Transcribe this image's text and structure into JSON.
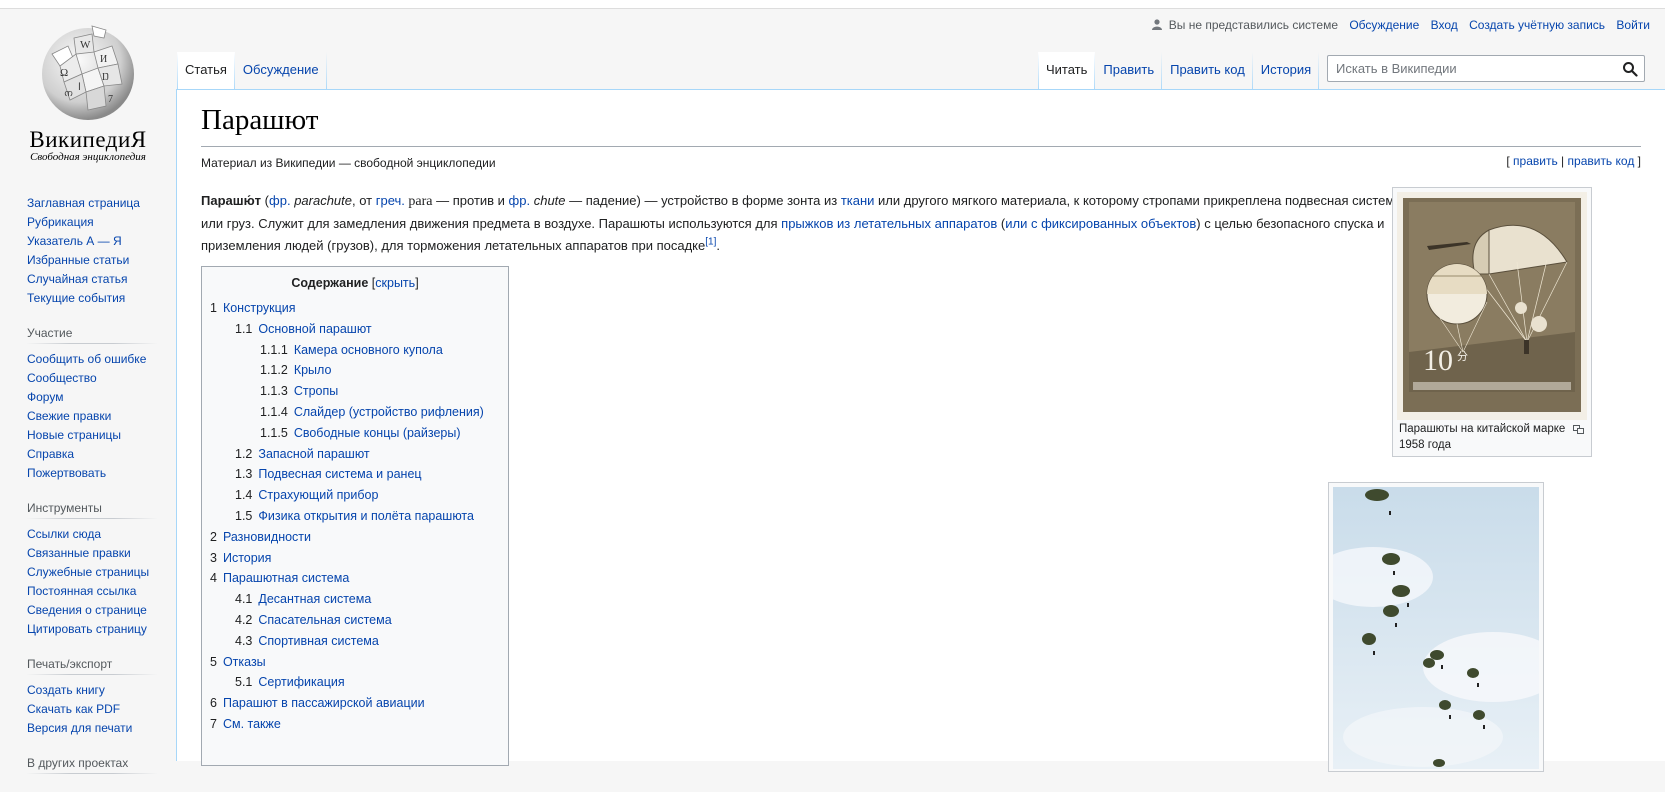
{
  "logo": {
    "wordmark": "ВикипедиЯ",
    "tagline": "Свободная энциклопедия"
  },
  "sidebar": {
    "navigation": [
      "Заглавная страница",
      "Рубрикация",
      "Указатель А — Я",
      "Избранные статьи",
      "Случайная статья",
      "Текущие события"
    ],
    "participation": {
      "heading": "Участие",
      "items": [
        "Сообщить об ошибке",
        "Сообщество",
        "Форум",
        "Свежие правки",
        "Новые страницы",
        "Справка",
        "Пожертвовать"
      ]
    },
    "tools": {
      "heading": "Инструменты",
      "items": [
        "Ссылки сюда",
        "Связанные правки",
        "Служебные страницы",
        "Постоянная ссылка",
        "Сведения о странице",
        "Цитировать страницу"
      ]
    },
    "print": {
      "heading": "Печать/экспорт",
      "items": [
        "Создать книгу",
        "Скачать как PDF",
        "Версия для печати"
      ]
    },
    "other": {
      "heading": "В других проектах"
    }
  },
  "personal": {
    "not_logged": "Вы не представились системе",
    "talk": "Обсуждение",
    "login": "Вход",
    "create": "Создать учётную запись",
    "logout": "Войти"
  },
  "tabs": {
    "left": [
      "Статья",
      "Обсуждение"
    ],
    "right": [
      "Читать",
      "Править",
      "Править код",
      "История"
    ]
  },
  "search": {
    "placeholder": "Искать в Википедии"
  },
  "article": {
    "title": "Парашют",
    "site_sub": "Материал из Википедии — свободной энциклопедии",
    "edit_open": "[ ",
    "edit": "править",
    "edit_sep": " | ",
    "edit_code": "править код",
    "edit_close": " ]",
    "lead": {
      "t1": "Парашю́т",
      "t2": " (",
      "t3": "фр.",
      "t4": " ",
      "t5": "parachute",
      "t6": ", от ",
      "t7": "греч.",
      "t8": " para",
      "t9": " — против и ",
      "t10": "фр.",
      "t11": " ",
      "t12": "chute",
      "t13": " — падение) — устройство в форме зонта из ",
      "t14": "ткани",
      "t15": " или другого мягкого материала, к которому стропами прикреплена подвесная система или груз. Служит для замедления движения предмета в воздухе. Парашюты используются для ",
      "t16": "прыжков из летательных аппаратов",
      "t17": " (",
      "t18": "или с фиксированных объектов",
      "t19": ") с целью безопасного спуска и приземления людей (грузов), для торможения летательных аппаратов при посадке",
      "ref": "[1]",
      "t20": "."
    }
  },
  "toc": {
    "title": "Содержание",
    "toggle_open": " [",
    "toggle": "скрыть",
    "toggle_close": "]",
    "items": [
      {
        "num": "1",
        "text": "Конструкция",
        "level": 1
      },
      {
        "num": "1.1",
        "text": "Основной парашют",
        "level": 2
      },
      {
        "num": "1.1.1",
        "text": "Камера основного купола",
        "level": 3
      },
      {
        "num": "1.1.2",
        "text": "Крыло",
        "level": 3
      },
      {
        "num": "1.1.3",
        "text": "Стропы",
        "level": 3
      },
      {
        "num": "1.1.4",
        "text": "Слайдер (устройство рифления)",
        "level": 3
      },
      {
        "num": "1.1.5",
        "text": "Свободные концы (райзеры)",
        "level": 3
      },
      {
        "num": "1.2",
        "text": "Запасной парашют",
        "level": 2
      },
      {
        "num": "1.3",
        "text": "Подвесная система и ранец",
        "level": 2
      },
      {
        "num": "1.4",
        "text": "Страхующий прибор",
        "level": 2
      },
      {
        "num": "1.5",
        "text": "Физика открытия и полёта парашюта",
        "level": 2
      },
      {
        "num": "2",
        "text": "Разновидности",
        "level": 1
      },
      {
        "num": "3",
        "text": "История",
        "level": 1
      },
      {
        "num": "4",
        "text": "Парашютная система",
        "level": 1
      },
      {
        "num": "4.1",
        "text": "Десантная система",
        "level": 2
      },
      {
        "num": "4.2",
        "text": "Спасательная система",
        "level": 2
      },
      {
        "num": "4.3",
        "text": "Спортивная система",
        "level": 2
      },
      {
        "num": "5",
        "text": "Отказы",
        "level": 1
      },
      {
        "num": "5.1",
        "text": "Сертификация",
        "level": 2
      },
      {
        "num": "6",
        "text": "Парашют в пассажирской авиации",
        "level": 1
      },
      {
        "num": "7",
        "text": "См. также",
        "level": 1
      }
    ]
  },
  "thumb1": {
    "caption": "Парашюты на китайской марке 1958 года",
    "stamp_value": "10",
    "stamp_unit": "分"
  },
  "colors": {
    "link": "#0645ad",
    "text": "#202122",
    "border": "#a7d7f9"
  }
}
